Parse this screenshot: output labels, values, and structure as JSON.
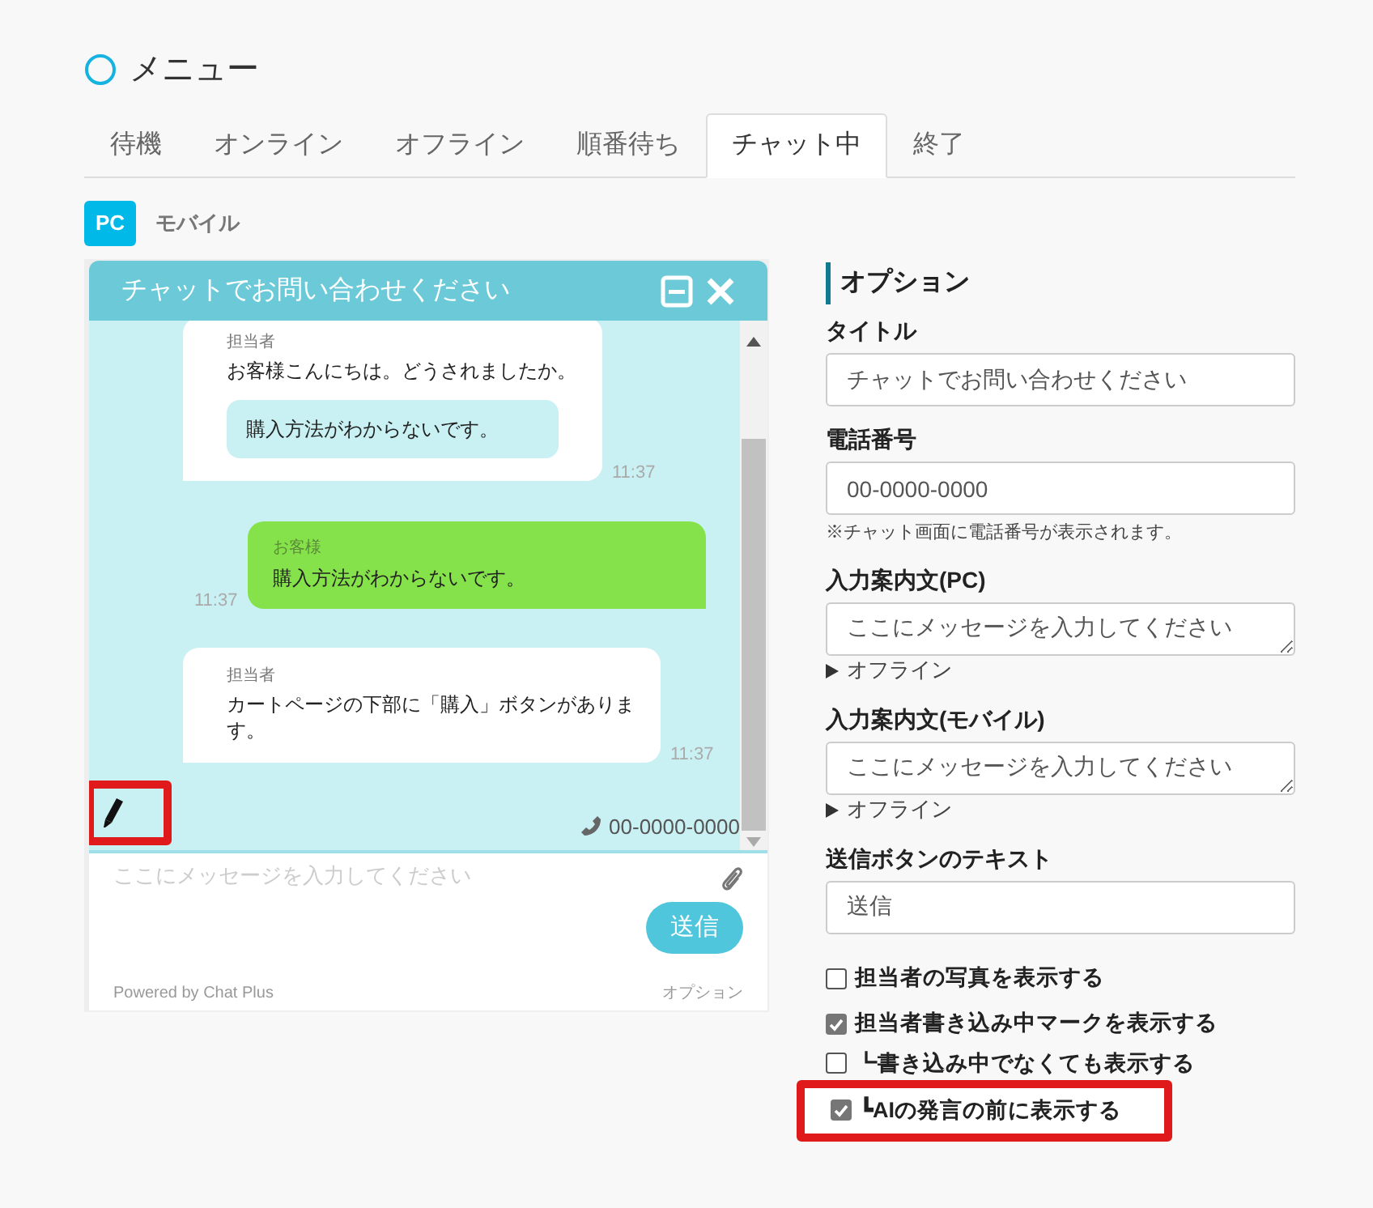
{
  "menu": {
    "title": "メニュー"
  },
  "tabs": [
    {
      "label": "待機",
      "selected": false
    },
    {
      "label": "オンライン",
      "selected": false
    },
    {
      "label": "オフライン",
      "selected": false
    },
    {
      "label": "順番待ち",
      "selected": false
    },
    {
      "label": "チャット中",
      "selected": true
    },
    {
      "label": "終了",
      "selected": false
    }
  ],
  "device_tabs": [
    {
      "label": "PC",
      "selected": true
    },
    {
      "label": "モバイル",
      "selected": false
    }
  ],
  "chat_preview": {
    "title": "チャットでお問い合わせください",
    "messages": [
      {
        "kind": "agent",
        "sender": "担当者",
        "text": "お客様こんにちは。どうされましたか。",
        "quote": "購入方法がわからないです。",
        "time": "11:37"
      },
      {
        "kind": "customer",
        "sender": "お客様",
        "text": "購入方法がわからないです。",
        "time": "11:37"
      },
      {
        "kind": "agent",
        "sender": "担当者",
        "text": "カートページの下部に「購入」ボタンがあります。",
        "time": "11:37"
      }
    ],
    "typing_indicator": {
      "highlighted": true
    },
    "phone": "00-0000-0000",
    "input_placeholder": "ここにメッセージを入力してください",
    "send_button": "送信",
    "footer": "Powered by Chat Plus",
    "footer_link": "オプション"
  },
  "options": {
    "heading": "オプション",
    "fields": [
      {
        "kind": "input",
        "label": "タイトル",
        "value": "チャットでお問い合わせください"
      },
      {
        "kind": "input",
        "label": "電話番号",
        "value": "00-0000-0000",
        "note": "※チャット画面に電話番号が表示されます。"
      },
      {
        "kind": "textarea",
        "label": "入力案内文(PC)",
        "value": "ここにメッセージを入力してください",
        "toggle": "オフライン"
      },
      {
        "kind": "textarea",
        "label": "入力案内文(モバイル)",
        "value": "ここにメッセージを入力してください",
        "toggle": "オフライン"
      },
      {
        "kind": "input",
        "label": "送信ボタンのテキスト",
        "value": "送信"
      }
    ],
    "checkboxes": [
      {
        "label": "担当者の写真を表示する",
        "checked": false,
        "highlighted": false
      },
      {
        "label": "担当者書き込み中マークを表示する",
        "checked": true,
        "highlighted": false
      },
      {
        "label": "┗書き込み中でなくても表示する",
        "checked": false,
        "highlighted": false
      },
      {
        "label": "┗AIの発言の前に表示する",
        "checked": true,
        "highlighted": true
      }
    ]
  }
}
